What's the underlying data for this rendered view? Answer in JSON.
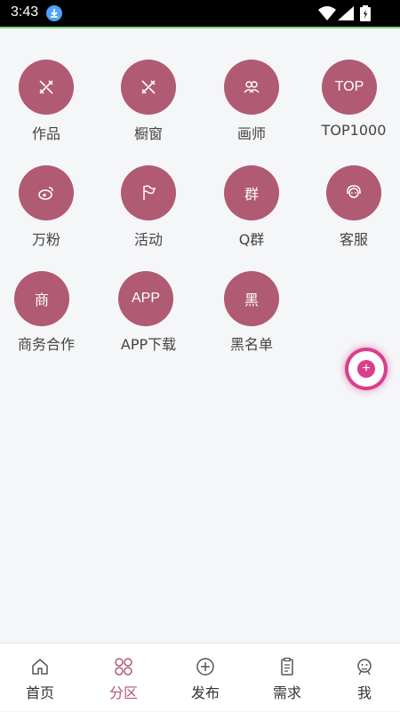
{
  "status_bar": {
    "time": "3:43"
  },
  "grid": [
    {
      "label": "作品",
      "icon": "pencil-ruler-icon",
      "text": ""
    },
    {
      "label": "橱窗",
      "icon": "pencil-ruler-icon",
      "text": ""
    },
    {
      "label": "画师",
      "icon": "users-icon",
      "text": ""
    },
    {
      "label": "TOP1000",
      "icon": "top-text-icon",
      "text": "TOP"
    },
    {
      "label": "万粉",
      "icon": "weibo-icon",
      "text": ""
    },
    {
      "label": "活动",
      "icon": "flag-icon",
      "text": ""
    },
    {
      "label": "Q群",
      "icon": "group-text-icon",
      "text": "群"
    },
    {
      "label": "客服",
      "icon": "customer-service-icon",
      "text": ""
    },
    {
      "label": "商务合作",
      "icon": "business-text-icon",
      "text": "商"
    },
    {
      "label": "APP下载",
      "icon": "app-text-icon",
      "text": "APP"
    },
    {
      "label": "黑名单",
      "icon": "blacklist-text-icon",
      "text": "黑"
    }
  ],
  "fab": {
    "glyph": "+"
  },
  "tabs": [
    {
      "label": "首页",
      "icon": "home-icon",
      "active": false
    },
    {
      "label": "分区",
      "icon": "grid-circles-icon",
      "active": true
    },
    {
      "label": "发布",
      "icon": "plus-circle-icon",
      "active": false
    },
    {
      "label": "需求",
      "icon": "clipboard-icon",
      "active": false
    },
    {
      "label": "我",
      "icon": "smiley-icon",
      "active": false
    }
  ],
  "colors": {
    "accent": "#b05a73",
    "fab": "#d83f8c",
    "background": "#f5f6f8"
  }
}
